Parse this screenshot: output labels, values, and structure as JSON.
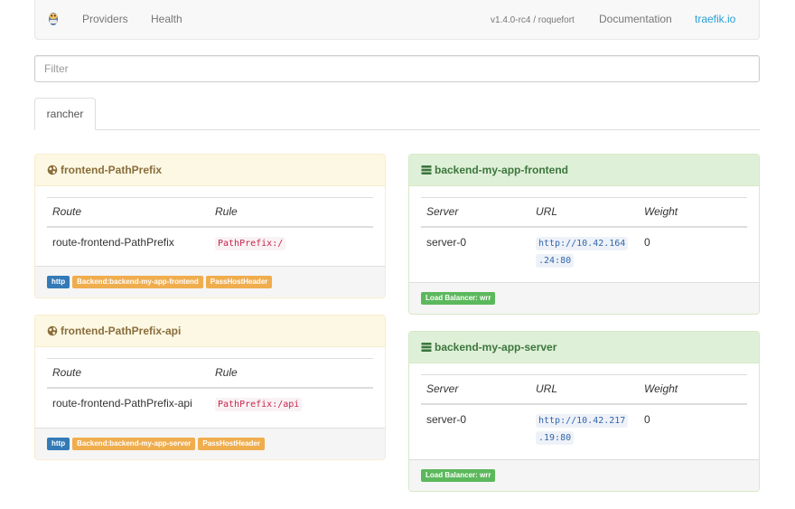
{
  "navbar": {
    "providers": "Providers",
    "health": "Health",
    "version": "v1.4.0-rc4 / roquefort",
    "docs": "Documentation",
    "traefik": "traefik.io"
  },
  "filter": {
    "placeholder": "Filter"
  },
  "tabs": [
    {
      "label": "rancher"
    }
  ],
  "frontends": [
    {
      "title": "frontend-PathPrefix",
      "headers": {
        "route": "Route",
        "rule": "Rule"
      },
      "route": "route-frontend-PathPrefix",
      "rule": "PathPrefix:/",
      "labels": {
        "entry": "http",
        "backend": "Backend:backend-my-app-frontend",
        "passhost": "PassHostHeader"
      }
    },
    {
      "title": "frontend-PathPrefix-api",
      "headers": {
        "route": "Route",
        "rule": "Rule"
      },
      "route": "route-frontend-PathPrefix-api",
      "rule": "PathPrefix:/api",
      "labels": {
        "entry": "http",
        "backend": "Backend:backend-my-app-server",
        "passhost": "PassHostHeader"
      }
    }
  ],
  "backends": [
    {
      "title": "backend-my-app-frontend",
      "headers": {
        "server": "Server",
        "url": "URL",
        "weight": "Weight"
      },
      "server": "server-0",
      "url_line1": "http://10.42.164",
      "url_line2": ".24:80",
      "weight": "0",
      "lb": "Load Balancer: wrr"
    },
    {
      "title": "backend-my-app-server",
      "headers": {
        "server": "Server",
        "url": "URL",
        "weight": "Weight"
      },
      "server": "server-0",
      "url_line1": "http://10.42.217",
      "url_line2": ".19:80",
      "weight": "0",
      "lb": "Load Balancer: wrr"
    }
  ],
  "colors": {
    "frontend_header_bg": "#fcf8e3",
    "frontend_header_text": "#8a6d3b",
    "backend_header_bg": "#dff0d8",
    "backend_header_text": "#3c763d",
    "label_primary": "#337ab7",
    "label_warning": "#f0ad4e",
    "label_success": "#5cb85c",
    "link_active": "#2a9fd6"
  },
  "icons": {
    "logo": "traefik-gopher-logo",
    "frontend": "globe-icon",
    "backend": "server-stack-icon"
  }
}
